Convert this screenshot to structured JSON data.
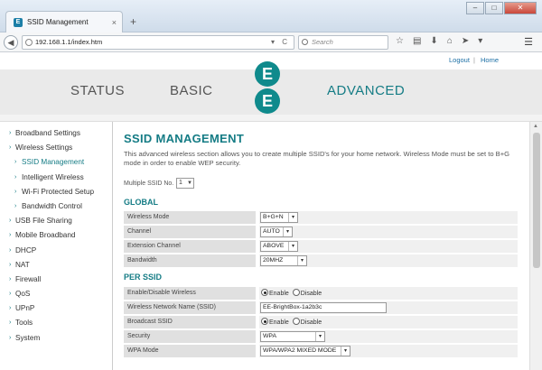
{
  "browser": {
    "tab_title": "SSID Management",
    "tab_favicon": "E",
    "tab_close": "×",
    "new_tab": "+",
    "url": "192.168.1.1/index.htm",
    "url_icons": "▾ C",
    "search_placeholder": "Search",
    "window_buttons": {
      "minimize": "–",
      "maximize": "□",
      "close": "✕"
    },
    "toolbar_icons": [
      "☆",
      "▤",
      "⬇",
      "⌂",
      "➤",
      "▾"
    ],
    "menu": "☰"
  },
  "header": {
    "logout": "Logout",
    "separator": "|",
    "home": "Home",
    "tabs": {
      "status": "STATUS",
      "basic": "BASIC",
      "advanced": "ADVANCED"
    },
    "logo_letters": [
      "E",
      "E"
    ]
  },
  "sidebar": {
    "items": [
      {
        "label": "Broadband Settings"
      },
      {
        "label": "Wireless Settings"
      },
      {
        "label": "SSID Management"
      },
      {
        "label": "Intelligent Wireless"
      },
      {
        "label": "Wi-Fi Protected Setup"
      },
      {
        "label": "Bandwidth Control"
      },
      {
        "label": "USB File Sharing"
      },
      {
        "label": "Mobile Broadband"
      },
      {
        "label": "DHCP"
      },
      {
        "label": "NAT"
      },
      {
        "label": "Firewall"
      },
      {
        "label": "QoS"
      },
      {
        "label": "UPnP"
      },
      {
        "label": "Tools"
      },
      {
        "label": "System"
      }
    ]
  },
  "main": {
    "title": "SSID MANAGEMENT",
    "intro": "This advanced wireless section allows you to create multiple SSID's for your home network. Wireless Mode must be set to B+G mode in order to enable WEP security.",
    "multiple_ssid_label": "Multiple SSID No.",
    "multiple_ssid_value": "1",
    "global": {
      "title": "GLOBAL",
      "rows": [
        {
          "label": "Wireless Mode",
          "value": "B+G+N"
        },
        {
          "label": "Channel",
          "value": "AUTO"
        },
        {
          "label": "Extension Channel",
          "value": "ABOVE"
        },
        {
          "label": "Bandwidth",
          "value": "20MHZ"
        }
      ]
    },
    "per_ssid": {
      "title": "PER SSID",
      "enable_label": "Enable/Disable Wireless",
      "ssid_label": "Wireless Network Name (SSID)",
      "ssid_value": "EE-BrightBox-1a2b3c",
      "broadcast_label": "Broadcast SSID",
      "security_label": "Security",
      "security_value": "WPA",
      "wpa_mode_label": "WPA Mode",
      "wpa_mode_value": "WPA/WPA2 MIXED MODE",
      "radio_enable": "Enable",
      "radio_disable": "Disable"
    }
  },
  "colors": {
    "accent": "#157c85",
    "logo": "#0f8a8c"
  }
}
